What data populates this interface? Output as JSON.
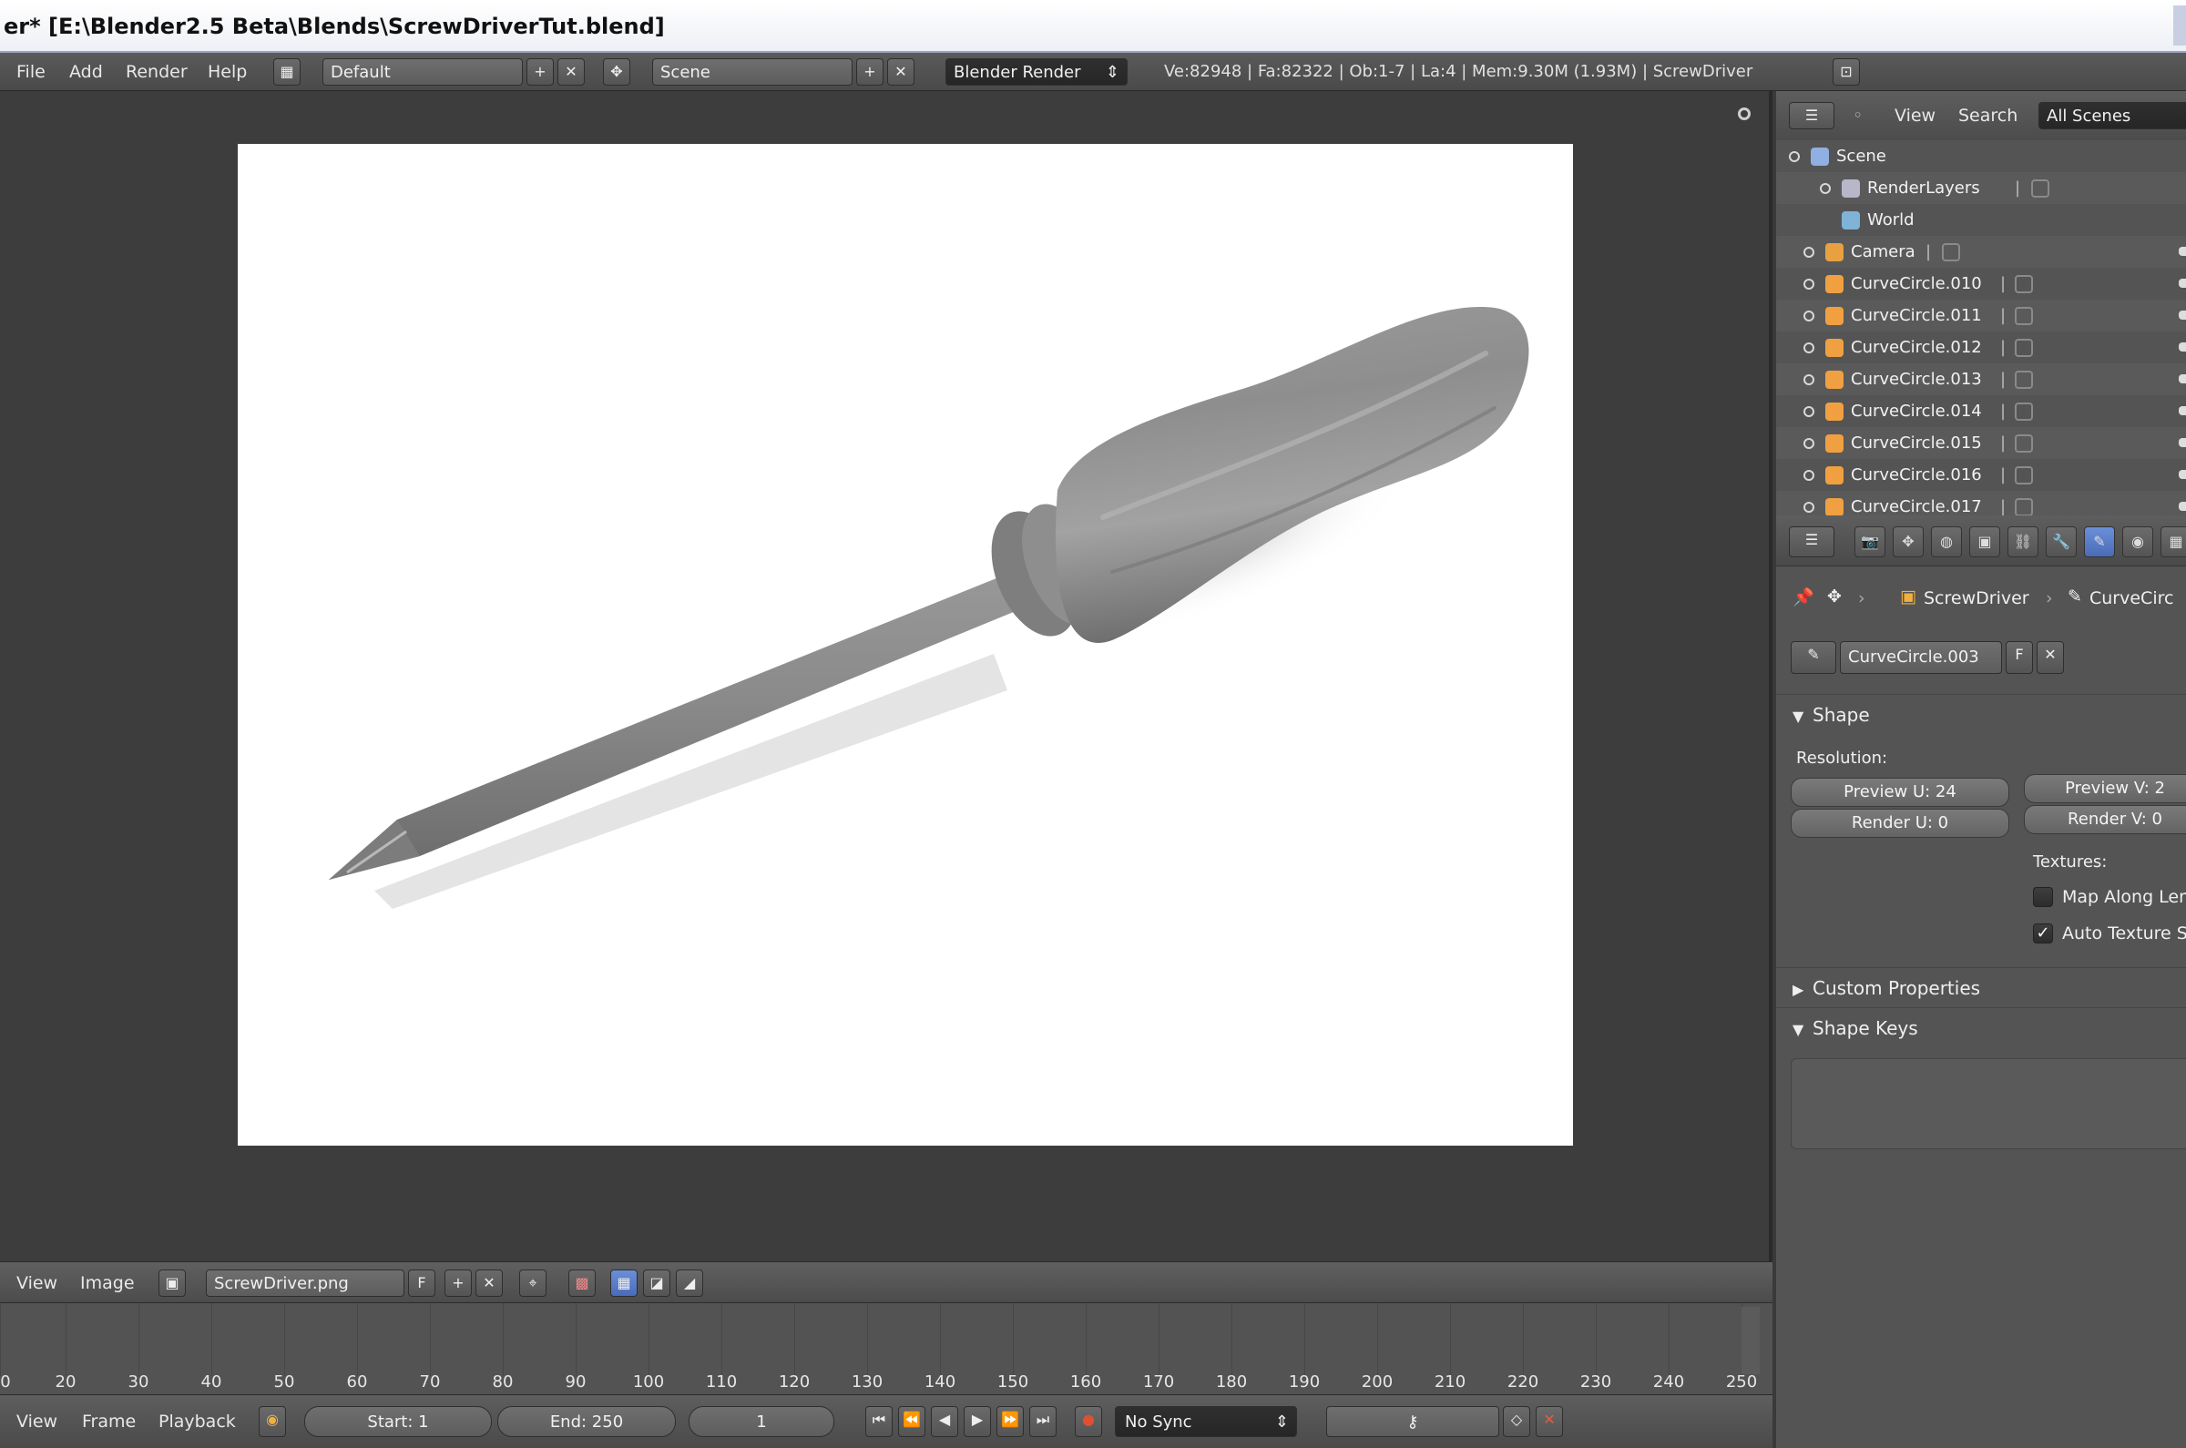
{
  "window": {
    "title": "er* [E:\\Blender2.5 Beta\\Blends\\ScrewDriverTut.blend]"
  },
  "top_header": {
    "menus": [
      "File",
      "Add",
      "Render",
      "Help"
    ],
    "screen_layout": "Default",
    "scene": "Scene",
    "render_engine": "Blender Render",
    "stats": "Ve:82948 | Fa:82322 | Ob:1-7 | La:4 | Mem:9.30M (1.93M) | ScrewDriver"
  },
  "image_editor": {
    "menus": [
      "View",
      "Image"
    ],
    "image_name": "ScrewDriver.png",
    "fake_user_label": "F"
  },
  "outliner": {
    "menus": [
      "View",
      "Search"
    ],
    "display_mode": "All Scenes",
    "items": [
      {
        "label": "Scene",
        "icon": "scene-icon",
        "color": "#8fb0e0"
      },
      {
        "label": "RenderLayers",
        "icon": "render-layers-icon",
        "color": "#b7b7c9"
      },
      {
        "label": "World",
        "icon": "world-icon",
        "color": "#7fb3d8"
      },
      {
        "label": "Camera",
        "icon": "camera-icon",
        "color": "#e8a040"
      },
      {
        "label": "CurveCircle.010",
        "icon": "curve-icon",
        "color": "#f0a040"
      },
      {
        "label": "CurveCircle.011",
        "icon": "curve-icon",
        "color": "#f0a040"
      },
      {
        "label": "CurveCircle.012",
        "icon": "curve-icon",
        "color": "#f0a040"
      },
      {
        "label": "CurveCircle.013",
        "icon": "curve-icon",
        "color": "#f0a040"
      },
      {
        "label": "CurveCircle.014",
        "icon": "curve-icon",
        "color": "#f0a040"
      },
      {
        "label": "CurveCircle.015",
        "icon": "curve-icon",
        "color": "#f0a040"
      },
      {
        "label": "CurveCircle.016",
        "icon": "curve-icon",
        "color": "#f0a040"
      },
      {
        "label": "CurveCircle.017",
        "icon": "curve-icon",
        "color": "#f0a040"
      }
    ]
  },
  "properties": {
    "breadcrumb_object": "ScrewDriver",
    "breadcrumb_data": "CurveCirc",
    "datablock_name": "CurveCircle.003",
    "fake_user_label": "F",
    "shape_panel": {
      "title": "Shape",
      "resolution_label": "Resolution:",
      "preview_u": "Preview U: 24",
      "render_u": "Render U: 0",
      "preview_v": "Preview V: 2",
      "render_v": "Render V: 0",
      "textures_label": "Textures:",
      "map_along_length": {
        "label": "Map Along Len",
        "checked": false
      },
      "auto_texture_space": {
        "label": "Auto Texture S",
        "checked": true
      }
    },
    "custom_properties": "Custom Properties",
    "shape_keys": "Shape Keys",
    "accent": "#5a7fd0"
  },
  "timeline": {
    "tick_labels": [
      "0",
      "20",
      "30",
      "40",
      "50",
      "60",
      "70",
      "80",
      "90",
      "100",
      "110",
      "120",
      "130",
      "140",
      "150",
      "160",
      "170",
      "180",
      "190",
      "200",
      "210",
      "220",
      "230",
      "240",
      "250"
    ],
    "menus": [
      "View",
      "Frame",
      "Playback"
    ],
    "start": "Start: 1",
    "end": "End: 250",
    "current_frame": "1",
    "sync_mode": "No Sync"
  }
}
